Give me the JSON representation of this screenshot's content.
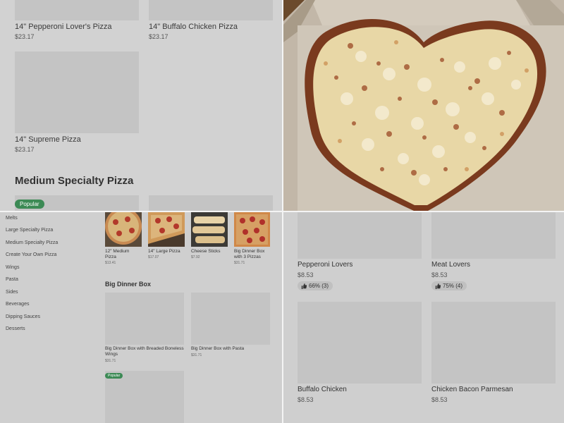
{
  "top_left": {
    "items": [
      {
        "name": "14\" Pepperoni Lover's Pizza",
        "price": "$23.17"
      },
      {
        "name": "14\" Buffalo Chicken Pizza",
        "price": "$23.17"
      },
      {
        "name": "14\" Supreme Pizza",
        "price": "$23.17"
      }
    ],
    "section_heading": "Medium Specialty Pizza",
    "badge": "Popular"
  },
  "bottom_left": {
    "sidebar": [
      "Melts",
      "Large Specialty Pizza",
      "Medium Specialty Pizza",
      "Create Your Own Pizza",
      "Wings",
      "Pasta",
      "Sides",
      "Beverages",
      "Dipping Sauces",
      "Desserts"
    ],
    "top_items": [
      {
        "name": "12\" Medium Pizza",
        "price": "$13.41"
      },
      {
        "name": "14\" Large Pizza",
        "price": "$17.07"
      },
      {
        "name": "Cheese Sticks",
        "price": "$7.92"
      },
      {
        "name": "Big Dinner Box with 3 Pizzas",
        "price": "$31.71"
      }
    ],
    "section_heading": "Big Dinner Box",
    "box_items": [
      {
        "name": "Big Dinner Box with Breaded Boneless Wings",
        "price": "$31.71"
      },
      {
        "name": "Big Dinner Box with Pasta",
        "price": "$31.71"
      }
    ],
    "badge": "Popular"
  },
  "bottom_right": {
    "items": [
      {
        "name": "Pepperoni Lovers",
        "price": "$8.53",
        "rating": "66% (3)"
      },
      {
        "name": "Meat Lovers",
        "price": "$8.53",
        "rating": "75% (4)"
      },
      {
        "name": "Buffalo Chicken",
        "price": "$8.53"
      },
      {
        "name": "Chicken Bacon Parmesan",
        "price": "$8.53"
      }
    ]
  },
  "colors": {
    "badge_green": "#3c8a55",
    "overlay_gray": "#d2d2d2"
  },
  "icons": [
    "thumbs-up-icon"
  ]
}
